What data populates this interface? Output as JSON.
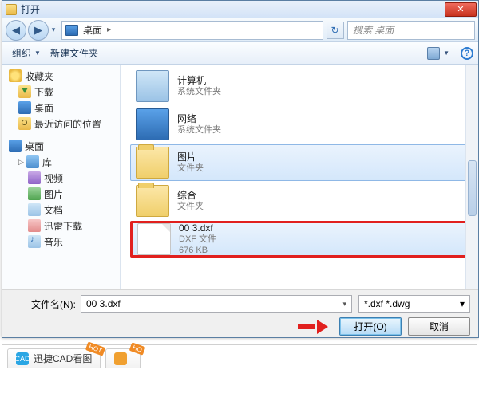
{
  "dialog": {
    "title": "打开",
    "close_glyph": "✕"
  },
  "nav": {
    "back_glyph": "◀",
    "fwd_glyph": "▶",
    "dropdown_glyph": "▾",
    "breadcrumb_location": "桌面",
    "breadcrumb_sep": "▸",
    "refresh_glyph": "↻",
    "search_placeholder": "搜索 桌面"
  },
  "toolbar": {
    "organize": "组织",
    "new_folder": "新建文件夹",
    "help_glyph": "?"
  },
  "tree": {
    "favorites": "收藏夹",
    "downloads": "下载",
    "desktop": "桌面",
    "recent": "最近访问的位置",
    "desktop2": "桌面",
    "libraries": "库",
    "videos": "视频",
    "pictures": "图片",
    "documents": "文档",
    "xunlei": "迅雷下载",
    "music": "音乐"
  },
  "list": {
    "items": [
      {
        "name": "计算机",
        "sub1": "系统文件夹",
        "sub2": ""
      },
      {
        "name": "网络",
        "sub1": "系统文件夹",
        "sub2": ""
      },
      {
        "name": "图片",
        "sub1": "文件夹",
        "sub2": ""
      },
      {
        "name": "综合",
        "sub1": "文件夹",
        "sub2": ""
      },
      {
        "name": "00 3.dxf",
        "sub1": "DXF 文件",
        "sub2": "676 KB"
      }
    ]
  },
  "footer": {
    "filename_label": "文件名(N):",
    "filename_value": "00 3.dxf",
    "filter_value": "*.dxf *.dwg",
    "open_label": "打开(O)",
    "cancel_label": "取消",
    "dropdown_glyph": "▾"
  },
  "bottom_tabs": {
    "tab1": {
      "label": "迅捷CAD看图",
      "badge": "HOT",
      "ico": "CAD"
    },
    "tab2": {
      "label": "",
      "badge": "HO",
      "ico": ""
    }
  }
}
